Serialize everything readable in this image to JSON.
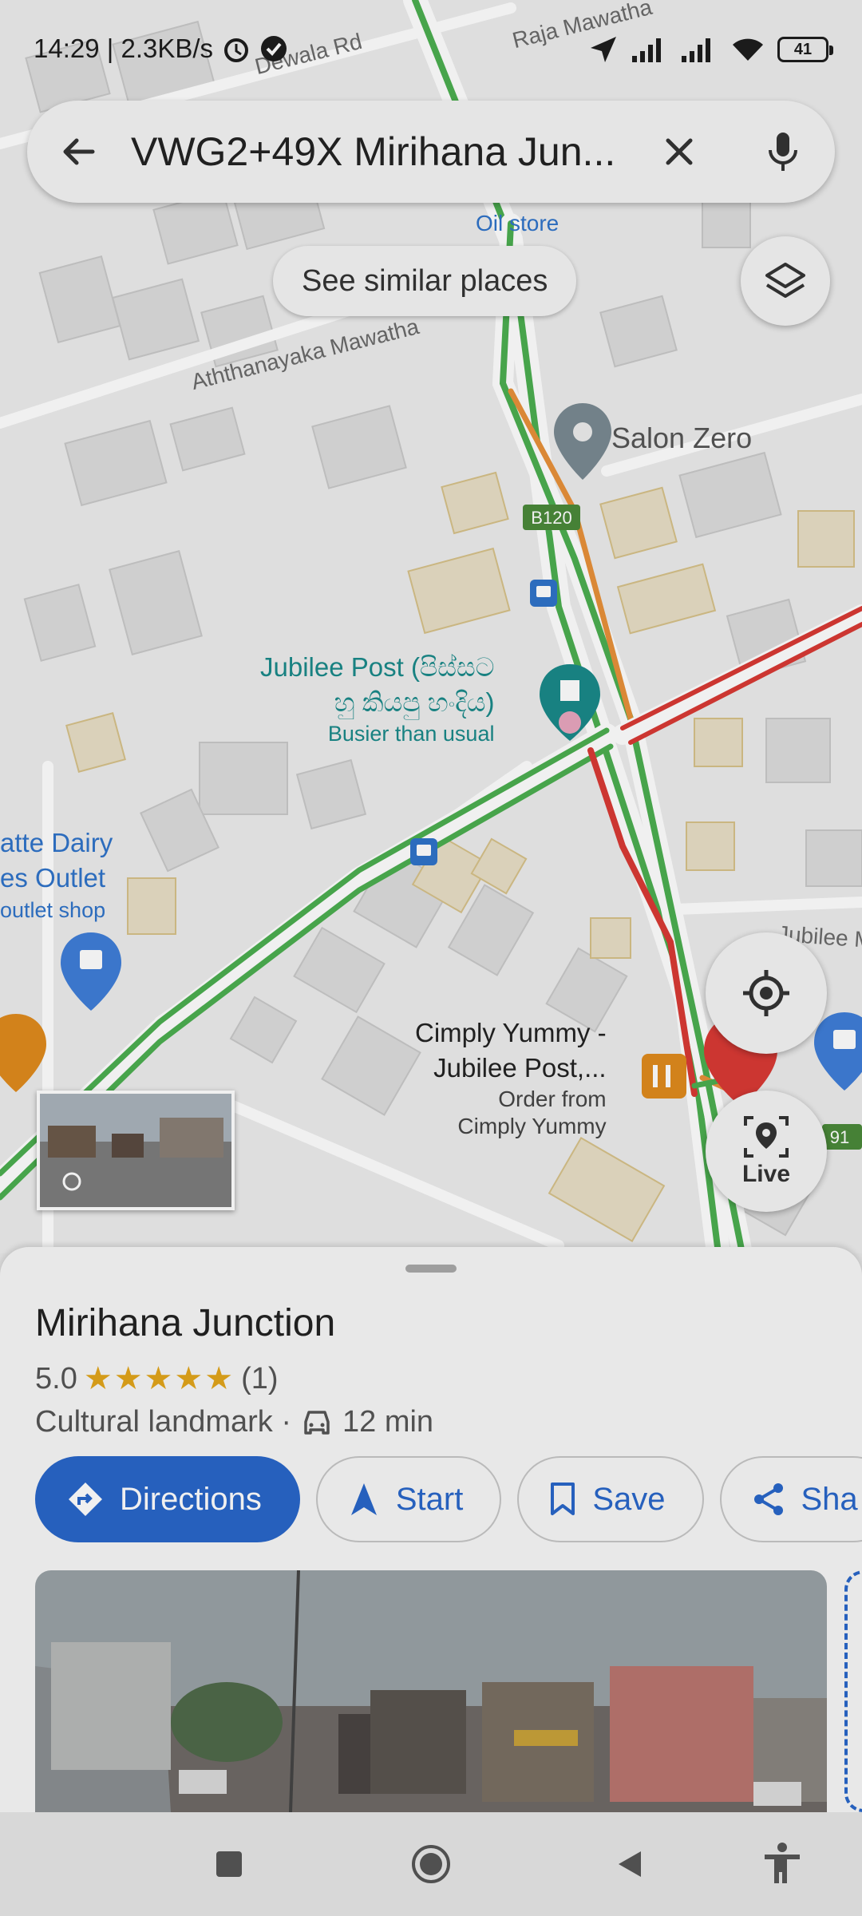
{
  "status_bar": {
    "time_speed": "14:29 | 2.3KB/s",
    "battery": "41"
  },
  "search": {
    "query": "VWG2+49X Mirihana Jun..."
  },
  "chip": {
    "label": "See similar places"
  },
  "map": {
    "streets": {
      "dewala": "Dewala Rd",
      "raja": "Raja Mawatha",
      "aththanayaka": "Aththanayaka Mawatha",
      "jubilee": "Jubilee M"
    },
    "oil_store": "Oil store",
    "salon": "Salon Zero",
    "road_badge_b120": "B120",
    "road_badge_91": "91",
    "jubilee_post": {
      "line1": "Jubilee Post (පිස්සට",
      "line2": "හු කියපු හංදිය)",
      "status": "Busier than usual"
    },
    "dairy": {
      "line1": "atte Dairy",
      "line2": "es Outlet",
      "sub": "outlet shop"
    },
    "cimply": {
      "line1": "Cimply Yummy -",
      "line2": "Jubilee Post,...",
      "sub1": "Order from",
      "sub2": "Cimply Yummy"
    },
    "live_label": "Live"
  },
  "place": {
    "name": "Mirihana Junction",
    "rating": "5.0",
    "stars": "★★★★★",
    "review_count": "(1)",
    "category": "Cultural landmark ·",
    "drive_time": "12 min"
  },
  "actions": {
    "directions": "Directions",
    "start": "Start",
    "save": "Save",
    "share": "Sha"
  },
  "colors": {
    "accent": "#2966c9",
    "traffic_green": "#4caf50",
    "traffic_orange": "#e8913a",
    "traffic_red": "#d93a35",
    "star": "#e2a51b"
  }
}
